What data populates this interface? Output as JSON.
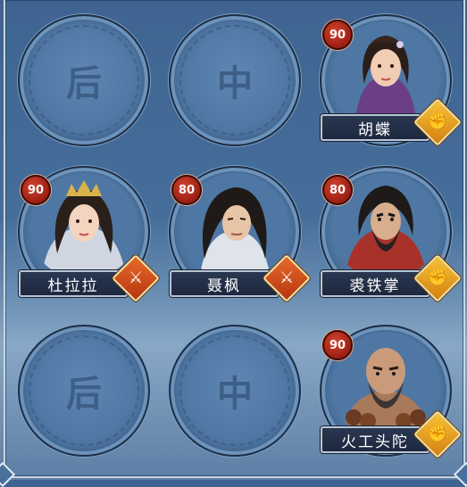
{
  "colors": {
    "fist_badge": "#e9a11f",
    "sword_badge": "#d04a1c",
    "level_badge": "#b52a18",
    "slot_glyph": "#3d5f86"
  },
  "formation": {
    "row1": [
      {
        "type": "empty",
        "glyph": "后"
      },
      {
        "type": "empty",
        "glyph": "中"
      },
      {
        "type": "hero",
        "name": "胡蝶",
        "level": "90",
        "badge": "fist-icon"
      }
    ],
    "row2": [
      {
        "type": "hero",
        "name": "杜拉拉",
        "level": "90",
        "badge": "swords-icon"
      },
      {
        "type": "hero",
        "name": "聂枫",
        "level": "80",
        "badge": "swords-icon"
      },
      {
        "type": "hero",
        "name": "裘铁掌",
        "level": "80",
        "badge": "fist-icon"
      }
    ],
    "row3": [
      {
        "type": "empty",
        "glyph": "后"
      },
      {
        "type": "empty",
        "glyph": "中"
      },
      {
        "type": "hero",
        "name": "火工头陀",
        "level": "90",
        "badge": "fist-icon"
      }
    ]
  }
}
